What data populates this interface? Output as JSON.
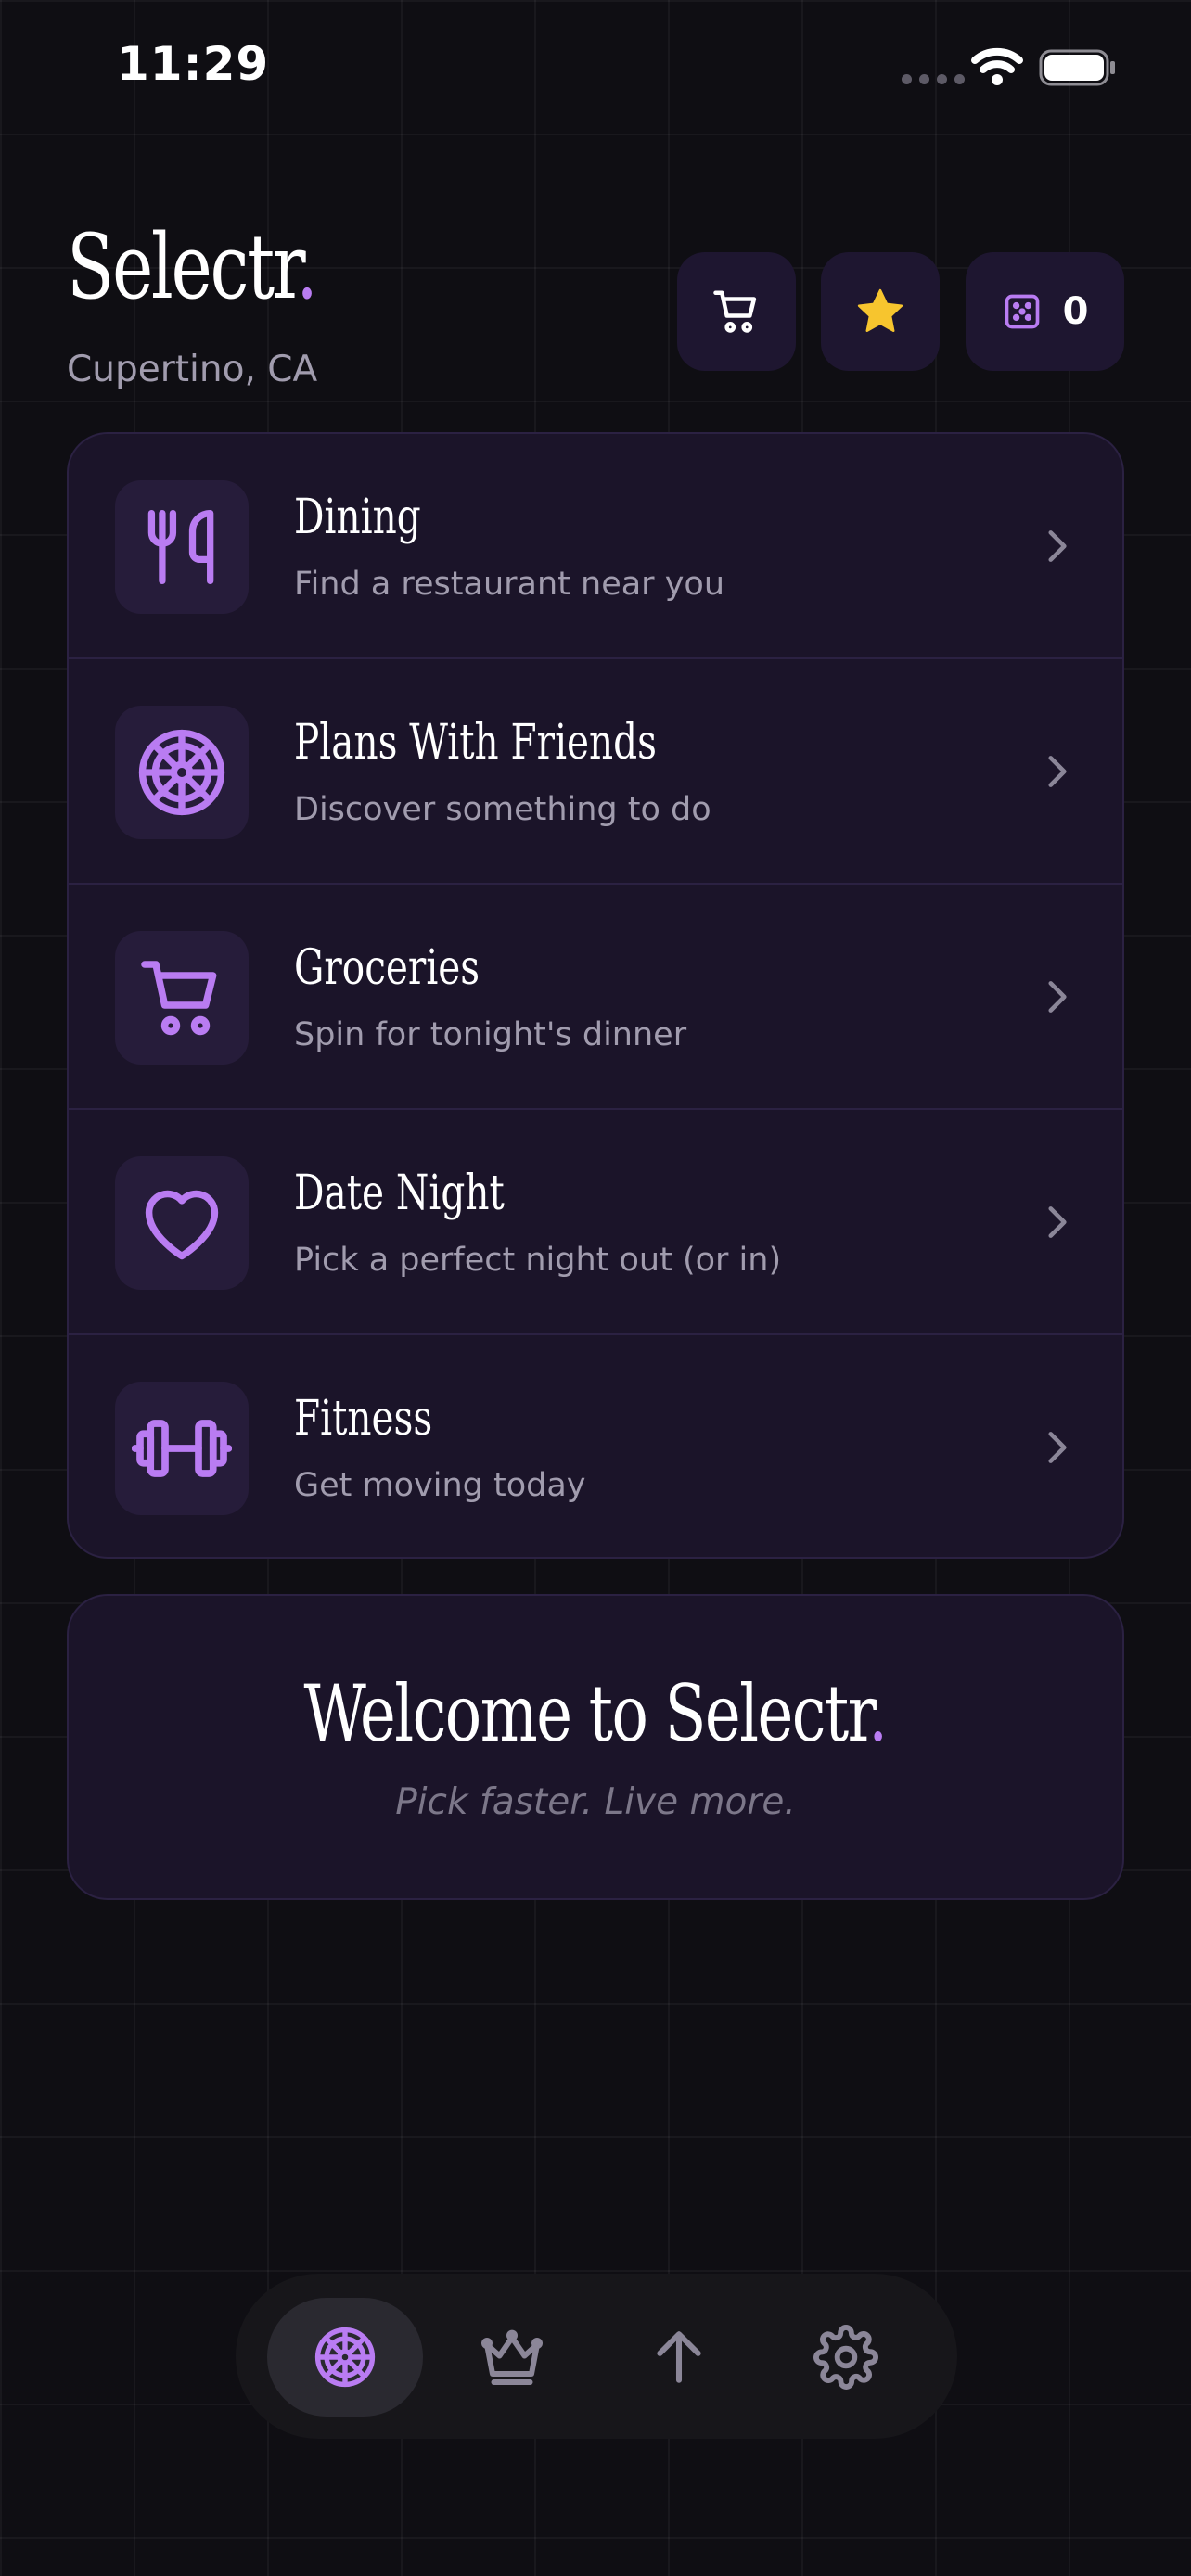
{
  "status_bar": {
    "time": "11:29"
  },
  "header": {
    "title": "Selectr",
    "title_dot": ".",
    "location": "Cupertino, CA",
    "dice_count": "0"
  },
  "categories": [
    {
      "title": "Dining",
      "subtitle": "Find a restaurant near you",
      "icon": "fork-knife-icon"
    },
    {
      "title": "Plans With Friends",
      "subtitle": "Discover something to do",
      "icon": "wheel-icon"
    },
    {
      "title": "Groceries",
      "subtitle": "Spin for tonight's dinner",
      "icon": "cart-icon"
    },
    {
      "title": "Date Night",
      "subtitle": "Pick a perfect night out (or in)",
      "icon": "heart-icon"
    },
    {
      "title": "Fitness",
      "subtitle": "Get moving today",
      "icon": "dumbbell-icon"
    }
  ],
  "welcome": {
    "title": "Welcome to Selectr",
    "title_dot": ".",
    "subtitle": "Pick faster. Live more."
  },
  "tabs": [
    {
      "name": "home",
      "icon": "wheel-icon",
      "active": true
    },
    {
      "name": "crown",
      "icon": "crown-icon",
      "active": false
    },
    {
      "name": "upload",
      "icon": "arrow-up-icon",
      "active": false
    },
    {
      "name": "settings",
      "icon": "gear-icon",
      "active": false
    }
  ],
  "colors": {
    "background": "#0f0e13",
    "card": "#1b1429",
    "accent": "#b97cf2",
    "star": "#f7c52e",
    "muted_text": "#a19cae"
  }
}
